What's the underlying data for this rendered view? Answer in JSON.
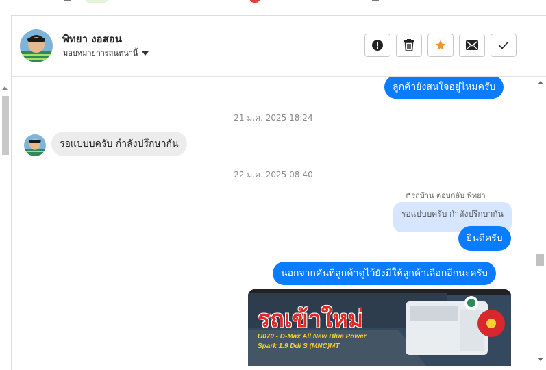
{
  "contact": {
    "name": "พิทยา งอสอน",
    "assign_label": "มอบหมายการสนทนานี้"
  },
  "actions": [
    {
      "name": "report-button",
      "icon": "exclamation-circle-icon"
    },
    {
      "name": "delete-button",
      "icon": "trash-icon"
    },
    {
      "name": "star-button",
      "icon": "star-icon"
    },
    {
      "name": "mail-button",
      "icon": "envelope-icon"
    },
    {
      "name": "done-button",
      "icon": "check-icon"
    }
  ],
  "colors": {
    "accent": "#0a7cff",
    "star": "#f4932b",
    "incoming_bg": "#ececec",
    "quoted_bg": "#d7e6ff"
  },
  "messages": {
    "m1": "ลูกค้ายังสนใจอยู่ไหมครับ",
    "ts1": "21 ม.ค. 2025 18:24",
    "m2": "รอแปบบครับ  กำลังปรึกษากัน",
    "ts2": "22 ม.ค. 2025 08:40",
    "reply_context": "รถบ้าน ตอบกลับ พิทยา",
    "quoted": "รอแปบบครับ กำลังปรึกษากัน",
    "m3": "ยินดีครับ",
    "m4": "นอกจากคันที่ลูกค้าดูไว้ยังมีให้ลูกค้าเลือกอีกนะครับ"
  },
  "banner": {
    "title": "รถเข้าใหม่",
    "line1": "U070 - D-Max All New Blue Power",
    "line2": "Spark 1.9 Ddi S (MNC)MT"
  }
}
